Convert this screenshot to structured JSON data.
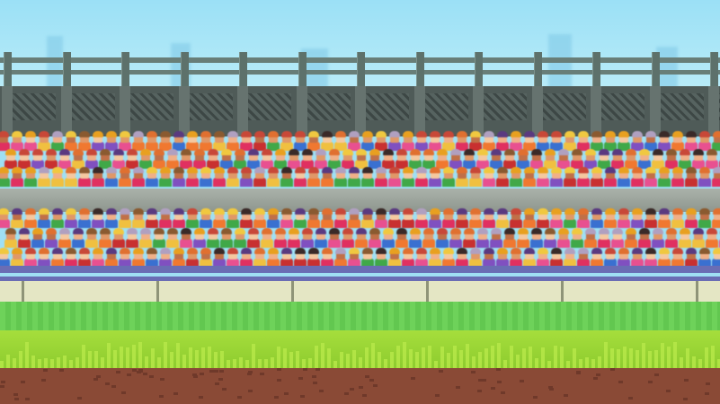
{
  "scene": {
    "name": "stadium-background",
    "palette": {
      "sky": "#9be0f6",
      "railing": "#687e78",
      "upper_wall": "#4f5b58",
      "ledge": "#a8b0a8",
      "barrier": "#e4e6c4",
      "barrier_trim": "#6a6db4",
      "grass_back": "#6ed25a",
      "grass_front": "#a6de3c",
      "dirt": "#8a4a36"
    },
    "fan_palette": {
      "hair": [
        "#e8a020",
        "#f0c840",
        "#3a2a28",
        "#c84838",
        "#8a5a30",
        "#b0a0c0",
        "#5a3a80",
        "#e07030"
      ],
      "shirt": [
        "#e03060",
        "#f07830",
        "#3a70d0",
        "#40a848",
        "#e85090",
        "#c83030",
        "#f0c040",
        "#8050c0"
      ],
      "skin": [
        "#f0b088",
        "#e09868",
        "#c07048",
        "#f4c8a0"
      ]
    },
    "crowd_sections": [
      {
        "name": "upper-stand",
        "rows": 3
      },
      {
        "name": "lower-stand",
        "rows": 3
      }
    ]
  }
}
